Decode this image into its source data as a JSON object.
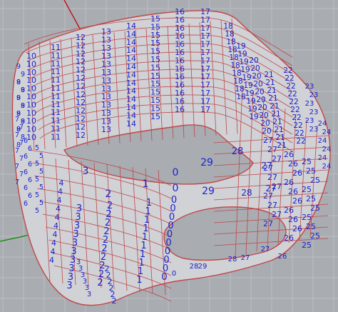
{
  "viewport": {
    "name": "3d-viewport",
    "background": "#a9acb1",
    "grid_color": "#bbbec3",
    "axis_x_color": "#c40000",
    "axis_y_color": "#008a00",
    "mesh_color": "#c0474a",
    "label_color": "#1c23cc"
  },
  "surface": {
    "name": "mesh-surface",
    "face_labels": [
      "0",
      "1",
      "2",
      "3",
      "4",
      "5",
      "6",
      "7",
      "8",
      "9",
      "10",
      "11",
      "12",
      "13",
      "14",
      "15",
      "16",
      "17",
      "18",
      "19",
      "20",
      "21",
      "22",
      "23",
      "24",
      "25",
      "26",
      "27",
      "28",
      "29"
    ]
  }
}
